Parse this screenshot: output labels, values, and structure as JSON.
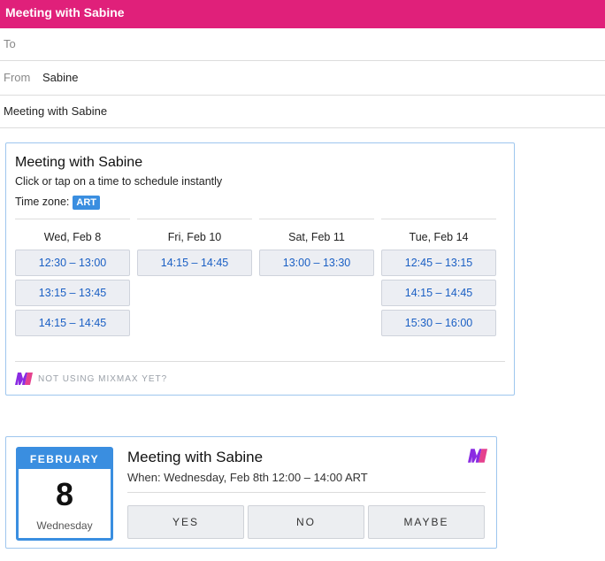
{
  "window": {
    "title": "Meeting with Sabine"
  },
  "compose": {
    "to_label": "To",
    "to_value": "",
    "from_label": "From",
    "from_value": "Sabine",
    "subject_value": "Meeting with Sabine"
  },
  "scheduler": {
    "title": "Meeting with Sabine",
    "subtitle": "Click or tap on a time to schedule instantly",
    "timezone_label": "Time zone:",
    "timezone_value": "ART",
    "days": [
      {
        "label": "Wed, Feb 8",
        "slots": [
          "12:30 – 13:00",
          "13:15 – 13:45",
          "14:15 – 14:45"
        ]
      },
      {
        "label": "Fri, Feb 10",
        "slots": [
          "14:15 – 14:45"
        ]
      },
      {
        "label": "Sat, Feb 11",
        "slots": [
          "13:00 – 13:30"
        ]
      },
      {
        "label": "Tue, Feb 14",
        "slots": [
          "12:45 – 13:15",
          "14:15 – 14:45",
          "15:30 – 16:00"
        ]
      }
    ],
    "footer_text": "NOT USING MIXMAX YET?",
    "logo_icon": "mixmax-logo-icon"
  },
  "event": {
    "calendar": {
      "month": "FEBRUARY",
      "day": "8",
      "weekday": "Wednesday"
    },
    "title": "Meeting with Sabine",
    "when": "When: Wednesday, Feb 8th 12:00 – 14:00 ART",
    "buttons": {
      "yes": "YES",
      "no": "NO",
      "maybe": "MAYBE"
    },
    "logo_icon": "mixmax-logo-icon"
  },
  "colors": {
    "titlebar": "#e0207a",
    "accent_blue": "#3a8ee0",
    "slot_text": "#1a5fc4",
    "logo_purple": "#8a2be2",
    "logo_pink": "#e0207a"
  }
}
